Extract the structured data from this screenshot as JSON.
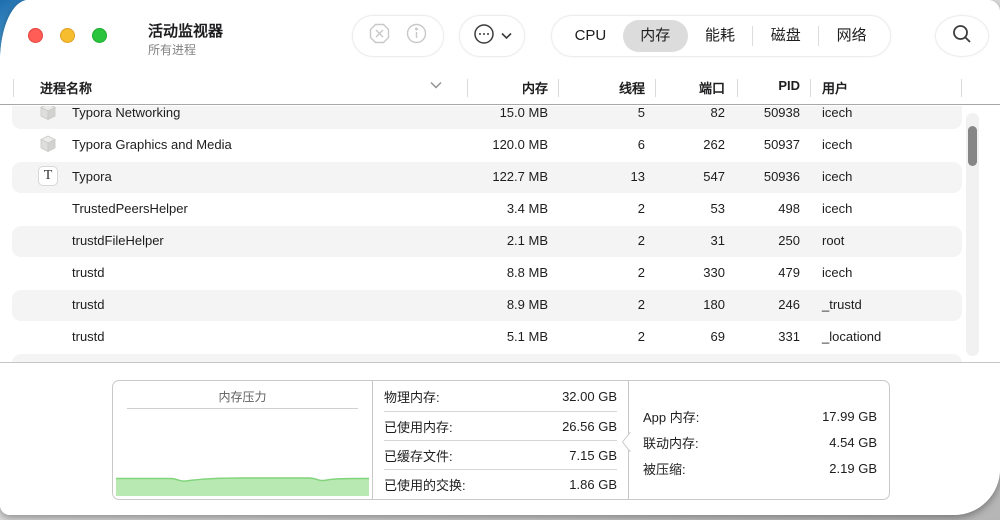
{
  "window": {
    "title": "活动监视器",
    "subtitle": "所有进程"
  },
  "toolbar": {
    "icons": {
      "stop": "stop-x-octagon",
      "inspect": "info-circle",
      "options": "ellipsis-circle",
      "options_chevron": "chevron-down",
      "search": "magnifier"
    },
    "tabs": [
      {
        "label": "CPU",
        "selected": false
      },
      {
        "label": "内存",
        "selected": true
      },
      {
        "label": "能耗",
        "selected": false
      },
      {
        "label": "磁盘",
        "selected": false
      },
      {
        "label": "网络",
        "selected": false
      }
    ]
  },
  "table": {
    "columns": {
      "name": "进程名称",
      "memory": "内存",
      "threads": "线程",
      "ports": "端口",
      "pid": "PID",
      "user": "用户"
    },
    "sort_indicator": "chevron-down",
    "rows": [
      {
        "icon": "cube",
        "name": "Typora Networking",
        "memory": "15.0 MB",
        "threads": "5",
        "ports": "82",
        "pid": "50938",
        "user": "icech",
        "shaded": true
      },
      {
        "icon": "cube",
        "name": "Typora Graphics and Media",
        "memory": "120.0 MB",
        "threads": "6",
        "ports": "262",
        "pid": "50937",
        "user": "icech",
        "shaded": false
      },
      {
        "icon": "typora",
        "name": "Typora",
        "memory": "122.7 MB",
        "threads": "13",
        "ports": "547",
        "pid": "50936",
        "user": "icech",
        "shaded": true
      },
      {
        "icon": null,
        "name": "TrustedPeersHelper",
        "memory": "3.4 MB",
        "threads": "2",
        "ports": "53",
        "pid": "498",
        "user": "icech",
        "shaded": false
      },
      {
        "icon": null,
        "name": "trustdFileHelper",
        "memory": "2.1 MB",
        "threads": "2",
        "ports": "31",
        "pid": "250",
        "user": "root",
        "shaded": true
      },
      {
        "icon": null,
        "name": "trustd",
        "memory": "8.8 MB",
        "threads": "2",
        "ports": "330",
        "pid": "479",
        "user": "icech",
        "shaded": false
      },
      {
        "icon": null,
        "name": "trustd",
        "memory": "8.9 MB",
        "threads": "2",
        "ports": "180",
        "pid": "246",
        "user": "_trustd",
        "shaded": true
      },
      {
        "icon": null,
        "name": "trustd",
        "memory": "5.1 MB",
        "threads": "2",
        "ports": "69",
        "pid": "331",
        "user": "_locationd",
        "shaded": false
      },
      {
        "icon": null,
        "name": "",
        "memory": "",
        "threads": "",
        "ports": "",
        "pid": "",
        "user": "",
        "shaded": true,
        "partial": true
      }
    ]
  },
  "footer": {
    "pressure": {
      "title": "内存压力",
      "level": "low",
      "fill_color": "#b9e9b2",
      "line_color": "#82d47c"
    },
    "stats_left": [
      {
        "label": "物理内存:",
        "value": "32.00 GB"
      },
      {
        "label": "已使用内存:",
        "value": "26.56 GB"
      },
      {
        "label": "已缓存文件:",
        "value": "7.15 GB"
      },
      {
        "label": "已使用的交换:",
        "value": "1.86 GB"
      }
    ],
    "stats_right": [
      {
        "label": "App 内存:",
        "value": "17.99 GB"
      },
      {
        "label": "联动内存:",
        "value": "4.54 GB"
      },
      {
        "label": "被压缩:",
        "value": "2.19 GB"
      }
    ]
  }
}
